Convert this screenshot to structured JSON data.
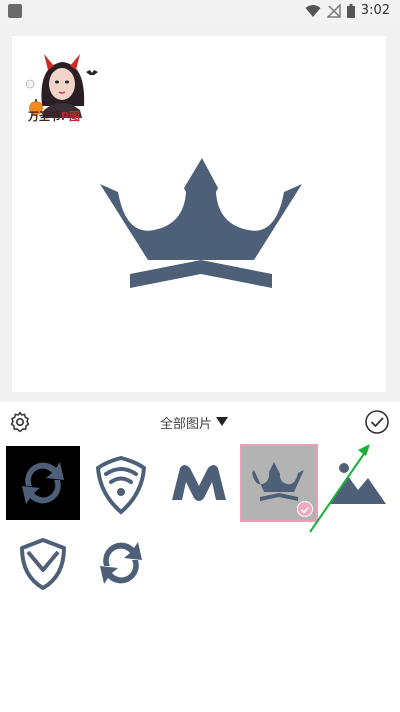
{
  "status_bar": {
    "time": "3:02"
  },
  "preview": {
    "sticker": {
      "caption_main": "万圣节",
      "caption_accent": "P图"
    }
  },
  "toolbar": {
    "album_label": "全部图片",
    "settings_icon": "gear-icon",
    "confirm_icon": "check-circle-icon",
    "dropdown_icon": "triangle-down-icon"
  },
  "colors": {
    "icon_slate": "#4d6078",
    "selected_bg": "#b3b3b3",
    "selected_border": "#e8a0b6",
    "arrow_green": "#16b23a"
  },
  "gallery": [
    {
      "icon": "sync-arrows-icon",
      "selected": false
    },
    {
      "icon": "wifi-shield-icon",
      "selected": false
    },
    {
      "icon": "m-logo-icon",
      "selected": false
    },
    {
      "icon": "crown-icon",
      "selected": true
    },
    {
      "icon": "mountain-image-icon",
      "selected": false
    },
    {
      "icon": "shield-check-icon",
      "selected": false
    },
    {
      "icon": "sync-arrows-icon",
      "selected": false
    }
  ]
}
